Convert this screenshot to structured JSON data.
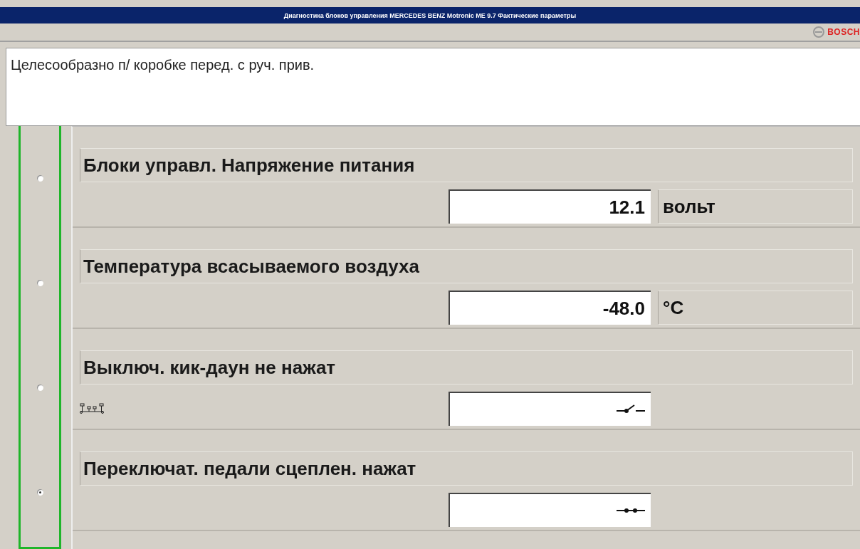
{
  "window": {
    "title": "Диагностика блоков управления  MERCEDES BENZ  Motronic ME 9.7  Фактические параметры"
  },
  "brand": {
    "name": "BOSCH"
  },
  "message": "Целесообразно п/ коробке перед. с руч. прив.",
  "rows": [
    {
      "kind": "value",
      "label": "Блоки управл. Напряжение питания",
      "value": "12.1",
      "unit": "вольт",
      "selected": false
    },
    {
      "kind": "value",
      "label": "Температура всасываемого воздуха",
      "value": "-48.0",
      "unit": "°C",
      "selected": false
    },
    {
      "kind": "switch",
      "label": "Выключ. кик-даун не нажат",
      "closed": false,
      "connector": true,
      "selected": false
    },
    {
      "kind": "switch",
      "label": "Переключат. педали сцеплен. нажат",
      "closed": true,
      "connector": false,
      "selected": true
    }
  ]
}
